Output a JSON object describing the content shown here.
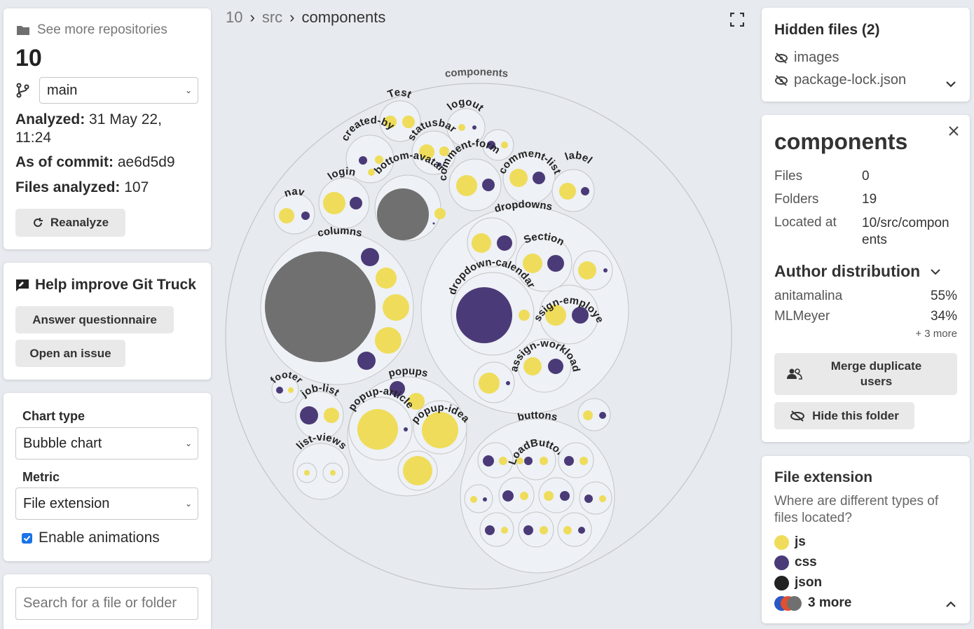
{
  "left": {
    "see_more": "See more repositories",
    "repo_name": "10",
    "branch": "main",
    "analyzed_label": "Analyzed:",
    "analyzed_value": "31 May 22,",
    "analyzed_time": "11:24",
    "commit_label": "As of commit:",
    "commit_value": "ae6d5d9",
    "files_label": "Files analyzed:",
    "files_value": "107",
    "reanalyze": "Reanalyze",
    "help_title": "Help improve Git Truck",
    "answer_btn": "Answer questionnaire",
    "issue_btn": "Open an issue",
    "chart_type_label": "Chart type",
    "chart_type_value": "Bubble chart",
    "metric_label": "Metric",
    "metric_value": "File extension",
    "animations_label": "Enable animations",
    "search_placeholder": "Search for a file or folder"
  },
  "breadcrumb": {
    "root": "10",
    "sep1": "›",
    "mid": "src",
    "sep2": "›",
    "current": "components"
  },
  "chart_labels": {
    "components": "components",
    "test": "Test",
    "logout": "logout",
    "created_by": "created-by",
    "statusbar": "statusbar",
    "comment_form": "comment-form",
    "comment_list": "comment-list",
    "label": "label",
    "login": "login",
    "bottom_avatar": "bottom-avatar",
    "nav": "nav",
    "dropdowns": "dropdowns",
    "columns": "columns",
    "section": "Section",
    "dropdown_calendar": "dropdown-calendar",
    "assign_employee": "assign-employee",
    "assign_workload": "assign-workload",
    "footer": "footer",
    "job_list": "job-list",
    "popups": "popups",
    "popup_article": "popup-article",
    "popup_idea": "popup-idea",
    "list_views": "list-views",
    "buttons": "buttons",
    "load_button": "LoadButton"
  },
  "hidden": {
    "title": "Hidden files (2)",
    "items": [
      "images",
      "package-lock.json"
    ]
  },
  "details": {
    "title": "components",
    "files_label": "Files",
    "files_value": "0",
    "folders_label": "Folders",
    "folders_value": "19",
    "located_label": "Located at",
    "located_value_1": "10/src/compon",
    "located_value_2": "ents",
    "author_title": "Author distribution",
    "authors": [
      {
        "name": "anitamalina",
        "pct": "55%"
      },
      {
        "name": "MLMeyer",
        "pct": "34%"
      }
    ],
    "more_authors": "+ 3 more",
    "merge_btn_1": "Merge duplicate",
    "merge_btn_2": "users",
    "hide_btn": "Hide this folder"
  },
  "legend": {
    "title": "File extension",
    "desc_1": "Where are different types of",
    "desc_2": "files located?",
    "items": [
      {
        "label": "js",
        "color": "#efdc5a"
      },
      {
        "label": "css",
        "color": "#4b3a78"
      },
      {
        "label": "json",
        "color": "#222222"
      }
    ],
    "more": "3 more"
  },
  "colors": {
    "js": "#efdc5a",
    "css": "#4b3a78",
    "other": "#707070"
  }
}
